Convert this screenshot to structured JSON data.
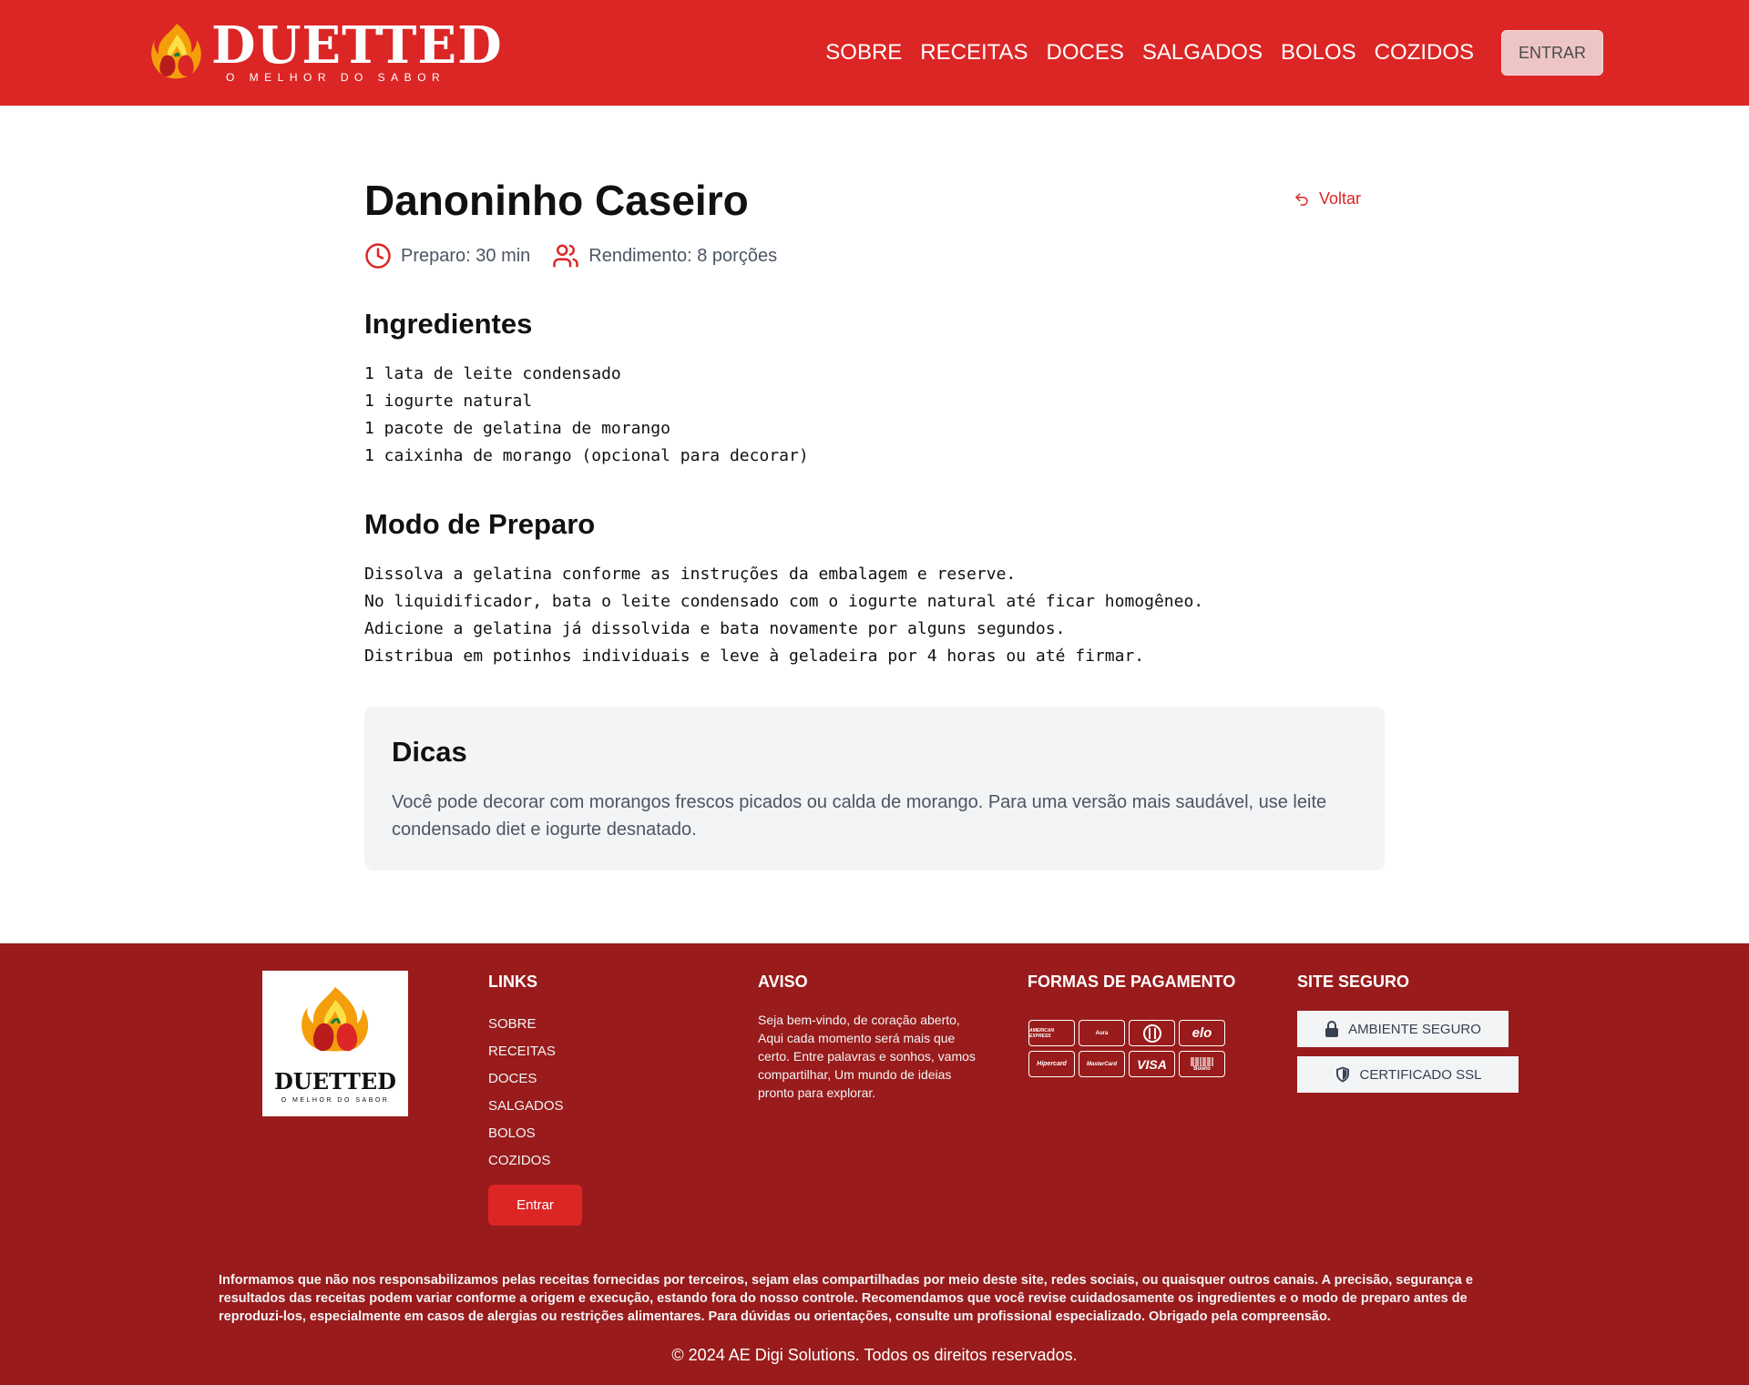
{
  "header": {
    "logo_title": "DUETTED",
    "logo_subtitle": "O MELHOR DO SABOR",
    "nav": [
      "SOBRE",
      "RECEITAS",
      "DOCES",
      "SALGADOS",
      "BOLOS",
      "COZIDOS"
    ],
    "login_label": "ENTRAR"
  },
  "recipe": {
    "title": "Danoninho Caseiro",
    "back_label": "Voltar",
    "prep_time": "Preparo: 30 min",
    "yield": "Rendimento: 8 porções",
    "ingredients_heading": "Ingredientes",
    "ingredients": [
      "1 lata de leite condensado",
      "1 iogurte natural",
      "1 pacote de gelatina de morango",
      "1 caixinha de morango (opcional para decorar)"
    ],
    "method_heading": "Modo de Preparo",
    "method": [
      "Dissolva a gelatina conforme as instruções da embalagem e reserve.",
      "No liquidificador, bata o leite condensado com o iogurte natural até ficar homogêneo.",
      "Adicione a gelatina já dissolvida e bata novamente por alguns segundos.",
      "Distribua em potinhos individuais e leve à geladeira por 4 horas ou até firmar."
    ],
    "tips_heading": "Dicas",
    "tips_text": "Você pode decorar com morangos frescos picados ou calda de morango. Para uma versão mais saudável, use leite condensado diet e iogurte desnatado."
  },
  "footer": {
    "logo_title": "DUETTED",
    "logo_subtitle": "O MELHOR DO SABOR",
    "links_heading": "LINKS",
    "links": [
      "SOBRE",
      "RECEITAS",
      "DOCES",
      "SALGADOS",
      "BOLOS",
      "COZIDOS"
    ],
    "login_label": "Entrar",
    "notice_heading": "AVISO",
    "notice_text": "Seja bem-vindo, de coração aberto, Aqui cada momento será mais que certo. Entre palavras e sonhos, vamos compartilhar, Um mundo de ideias pronto para explorar.",
    "payment_heading": "FORMAS DE PAGAMENTO",
    "payment_methods": [
      "AMERICAN EXPRESS",
      "Aura",
      "Diners",
      "elo",
      "Hipercard",
      "MasterCard",
      "VISA",
      "Boleto"
    ],
    "secure_heading": "SITE SEGURO",
    "secure_env": "AMBIENTE SEGURO",
    "ssl_cert": "CERTIFICADO SSL",
    "disclaimer": "Informamos que não nos responsabilizamos pelas receitas fornecidas por terceiros, sejam elas compartilhadas por meio deste site, redes sociais, ou quaisquer outros canais. A precisão, segurança e resultados das receitas podem variar conforme a origem e execução, estando fora do nosso controle. Recomendamos que você revise cuidadosamente os ingredientes e o modo de preparo antes de reproduzi-los, especialmente em casos de alergias ou restrições alimentares. Para dúvidas ou orientações, consulte um profissional especializado. Obrigado pela compreensão.",
    "copyright": "© 2024 AE Digi Solutions. Todos os direitos reservados."
  },
  "colors": {
    "header_red": "#dc2626",
    "footer_red": "#991b1b",
    "accent": "#dc2626"
  }
}
